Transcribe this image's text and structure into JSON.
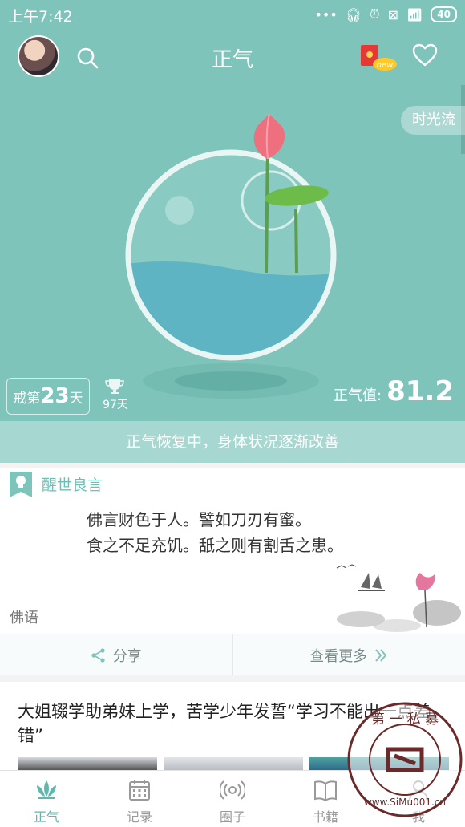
{
  "statusbar": {
    "time": "上午7:42",
    "battery": "40"
  },
  "appbar": {
    "title": "正气"
  },
  "hero": {
    "time_flow_label": "时光流",
    "streak_prefix": "戒第",
    "streak_days": "23",
    "streak_suffix": "天",
    "best_days": "97天",
    "zhengqi_label": "正气值:",
    "zhengqi_value": "81.2",
    "status_message": "正气恢复中，身体状况逐渐改善"
  },
  "quote": {
    "heading": "醒世良言",
    "lines": [
      "佛言财色于人。譬如刀刃有蜜。",
      "食之不足充饥。舐之则有割舌之患。"
    ],
    "source": "佛语",
    "share_label": "分享",
    "more_label": "查看更多"
  },
  "news": {
    "title": "大姐辍学助弟妹上学，苦学少年发誓“学习不能出一点差错”"
  },
  "bottom_nav": [
    {
      "label": "正气",
      "icon": "lotus-icon",
      "active": true
    },
    {
      "label": "记录",
      "icon": "calendar-icon",
      "active": false
    },
    {
      "label": "圈子",
      "icon": "broadcast-icon",
      "active": false
    },
    {
      "label": "书籍",
      "icon": "book-icon",
      "active": false
    },
    {
      "label": "我",
      "icon": "person-icon",
      "active": false
    }
  ],
  "watermark": {
    "text": "第一私募 www.SiMu001.cn"
  },
  "colors": {
    "primary": "#7fc4bb",
    "accent": "#5fb7ad",
    "band": "#a6d8d1"
  }
}
